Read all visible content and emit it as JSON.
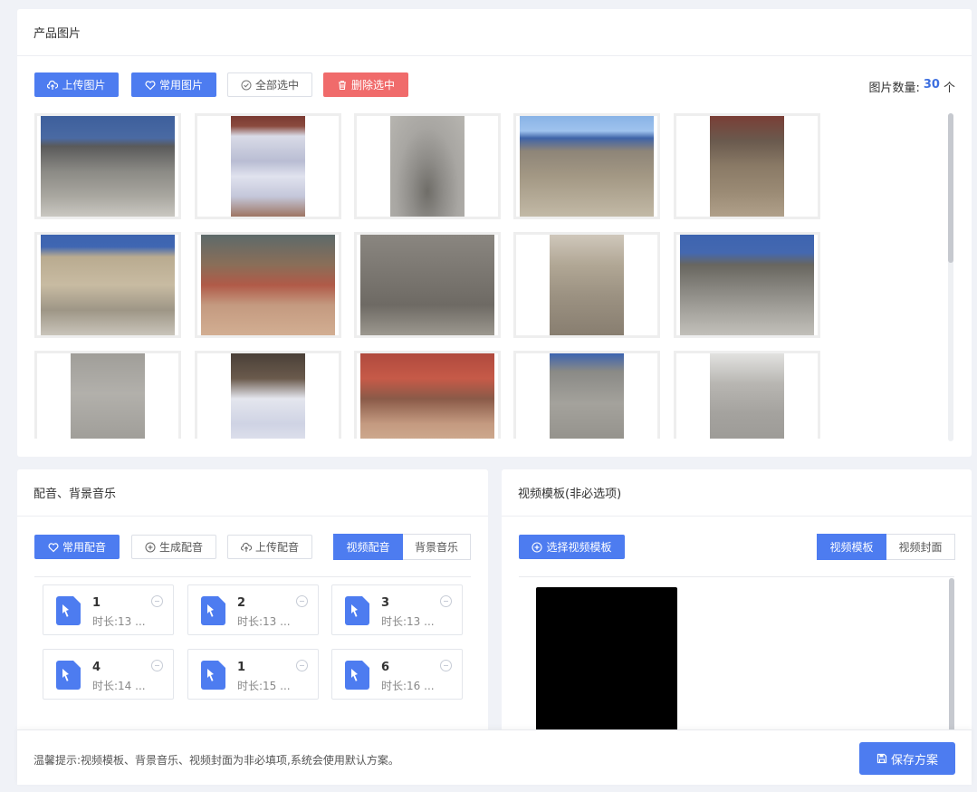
{
  "product_images": {
    "title": "产品图片",
    "buttons": {
      "upload": "上传图片",
      "common": "常用图片",
      "select_all": "全部选中",
      "delete": "删除选中"
    },
    "count_label": "图片数量:",
    "count_value": "30",
    "count_unit": "个"
  },
  "audio_section": {
    "title": "配音、背景音乐",
    "buttons": {
      "common": "常用配音",
      "generate": "生成配音",
      "upload": "上传配音"
    },
    "tabs": [
      "视频配音",
      "背景音乐"
    ],
    "items": [
      {
        "name": "1",
        "duration": "时长:13 ..."
      },
      {
        "name": "2",
        "duration": "时长:13 ..."
      },
      {
        "name": "3",
        "duration": "时长:13 ..."
      },
      {
        "name": "4",
        "duration": "时长:14 ..."
      },
      {
        "name": "1",
        "duration": "时长:15 ..."
      },
      {
        "name": "6",
        "duration": "时长:16 ..."
      }
    ]
  },
  "video_section": {
    "title": "视频模板(非必选项)",
    "select_button": "选择视频模板",
    "tabs": [
      "视频模板",
      "视频封面"
    ]
  },
  "footer": {
    "tip": "温馨提示:视频模板、背景音乐、视频封面为非必填项,系统会使用默认方案。",
    "save_button": "保存方案"
  },
  "colors": {
    "primary": "#4d7cf0",
    "danger": "#f06b6b",
    "count": "#3d6fe0"
  }
}
